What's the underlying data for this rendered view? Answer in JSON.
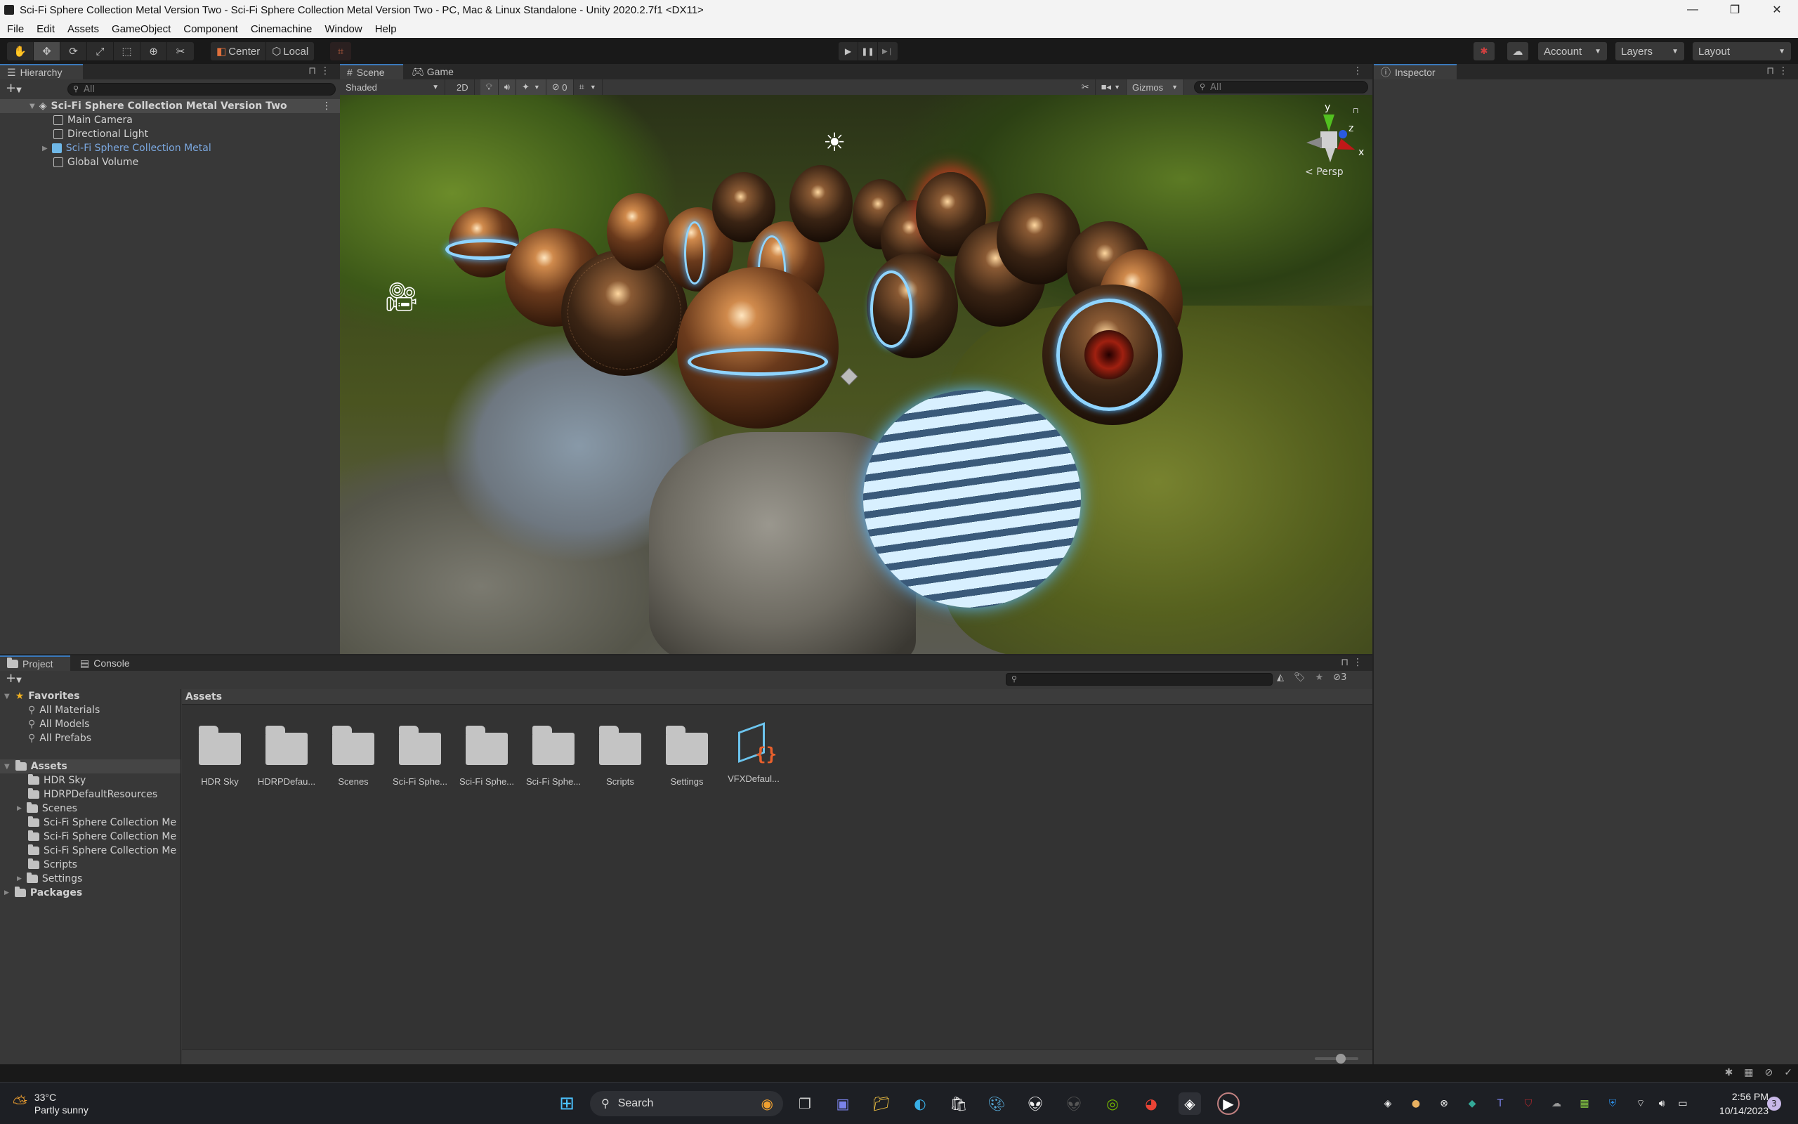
{
  "window": {
    "title": "Sci-Fi Sphere Collection Metal Version Two - Sci-Fi Sphere Collection Metal Version Two - PC, Mac & Linux Standalone - Unity 2020.2.7f1 <DX11>",
    "minimize": "—",
    "restore": "❐",
    "close": "✕"
  },
  "menu": [
    "File",
    "Edit",
    "Assets",
    "GameObject",
    "Component",
    "Cinemachine",
    "Window",
    "Help"
  ],
  "toolbar": {
    "tools": [
      {
        "name": "hand-tool",
        "glyph": "✋"
      },
      {
        "name": "move-tool",
        "glyph": "✥",
        "selected": true
      },
      {
        "name": "rotate-tool",
        "glyph": "⟳"
      },
      {
        "name": "scale-tool",
        "glyph": "⤢"
      },
      {
        "name": "rect-tool",
        "glyph": "⬚"
      },
      {
        "name": "transform-tool",
        "glyph": "⊕"
      },
      {
        "name": "custom-tool",
        "glyph": "✂"
      }
    ],
    "pivot_center": "Center",
    "pivot_local": "Local",
    "play": "▶",
    "pause": "❚❚",
    "step": "▶❘",
    "account": "Account",
    "layers": "Layers",
    "layout": "Layout"
  },
  "hierarchy": {
    "tab": "Hierarchy",
    "search_placeholder": "All",
    "scene": "Sci-Fi Sphere Collection Metal Version Two",
    "items": [
      {
        "label": "Main Camera",
        "type": "gameobject"
      },
      {
        "label": "Directional Light",
        "type": "gameobject"
      },
      {
        "label": "Sci-Fi Sphere Collection Metal",
        "type": "prefab"
      },
      {
        "label": "Global Volume",
        "type": "gameobject"
      }
    ]
  },
  "scene": {
    "tabs": [
      "Scene",
      "Game"
    ],
    "shading": "Shaded",
    "mode_2d": "2D",
    "hidden_count": "0",
    "gizmos": "Gizmos",
    "search_placeholder": "All",
    "projection": "Persp",
    "axes": {
      "x": "x",
      "y": "y",
      "z": "z"
    }
  },
  "inspector": {
    "tab": "Inspector"
  },
  "project": {
    "tabs": [
      "Project",
      "Console"
    ],
    "favorites": {
      "label": "Favorites",
      "items": [
        "All Materials",
        "All Models",
        "All Prefabs"
      ]
    },
    "assets_root": "Assets",
    "tree": [
      {
        "label": "HDR Sky",
        "expandable": false
      },
      {
        "label": "HDRPDefaultResources",
        "expandable": false
      },
      {
        "label": "Scenes",
        "expandable": true
      },
      {
        "label": "Sci-Fi Sphere Collection Me",
        "expandable": false
      },
      {
        "label": "Sci-Fi Sphere Collection Me",
        "expandable": false
      },
      {
        "label": "Sci-Fi Sphere Collection Me",
        "expandable": false
      },
      {
        "label": "Scripts",
        "expandable": false
      },
      {
        "label": "Settings",
        "expandable": true
      }
    ],
    "packages": "Packages",
    "breadcrumb": "Assets",
    "hidden_count": "3",
    "grid": [
      {
        "label": "HDR Sky",
        "type": "folder"
      },
      {
        "label": "HDRPDefau...",
        "type": "folder"
      },
      {
        "label": "Scenes",
        "type": "folder"
      },
      {
        "label": "Sci-Fi Sphe...",
        "type": "folder"
      },
      {
        "label": "Sci-Fi Sphe...",
        "type": "folder"
      },
      {
        "label": "Sci-Fi Sphe...",
        "type": "folder"
      },
      {
        "label": "Scripts",
        "type": "folder"
      },
      {
        "label": "Settings",
        "type": "folder"
      },
      {
        "label": "VFXDefaul...",
        "type": "vfx"
      }
    ]
  },
  "taskbar": {
    "weather_temp": "33°C",
    "weather_desc": "Partly sunny",
    "search": "Search",
    "time": "2:56 PM",
    "date": "10/14/2023",
    "notifications": "3"
  }
}
